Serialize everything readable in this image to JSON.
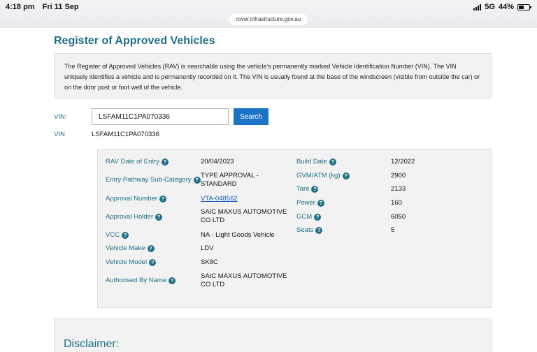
{
  "status_bar": {
    "time": "4:18 pm",
    "date": "Fri 11 Sep",
    "network": "5G",
    "battery": "44%"
  },
  "browser": {
    "url": "rover.infrastructure.gov.au"
  },
  "page": {
    "title": "Register of Approved Vehicles",
    "intro": "The Register of Approved Vehicles (RAV) is searchable using the vehicle's permanently marked Vehicle Identification Number (VIN). The VIN uniquely identifies a vehicle and is permanently recorded on it. The VIN is usually found at the base of the windscreen (visible from outside the car) or on the door post or foot well of the vehicle."
  },
  "search": {
    "label": "VIN:",
    "value": "LSFAM11C1PA070336",
    "button": "Search"
  },
  "result_vin": {
    "label": "VIN",
    "value": "LSFAM11C1PA070336"
  },
  "details": {
    "left": [
      {
        "label": "RAV Date of Entry",
        "value": "20/04/2023"
      },
      {
        "label": "Entry Pathway Sub-Category",
        "value_line1": "TYPE APPROVAL -",
        "value_line2": "STANDARD"
      },
      {
        "label": "Approval Number",
        "value": "VTA-048562"
      },
      {
        "label": "Approval Holder",
        "value_line1": "SAIC MAXUS AUTOMOTIVE",
        "value_line2": "CO LTD"
      },
      {
        "label": "VCC",
        "value": "NA - Light Goods Vehicle"
      },
      {
        "label": "Vehicle Make",
        "value": "LDV"
      },
      {
        "label": "Vehicle Model",
        "value": "SK8C"
      },
      {
        "label": "Authorised By Name",
        "value_line1": "SAIC MAXUS AUTOMOTIVE",
        "value_line2": "CO LTD"
      }
    ],
    "right": [
      {
        "label": "Build Date",
        "value": "12/2022"
      },
      {
        "label": "GVM/ATM (kg)",
        "value": "2900"
      },
      {
        "label": "Tare",
        "value": "2133"
      },
      {
        "label": "Power",
        "value": "160"
      },
      {
        "label": "GCM",
        "value": "6050"
      },
      {
        "label": "Seats",
        "value": "5"
      }
    ]
  },
  "disclaimer": {
    "title": "Disclaimer:"
  },
  "icons": {
    "help": "question-circle-icon",
    "signal": "cellular-signal-icon",
    "battery": "battery-icon"
  },
  "colors": {
    "heading": "#1e6f86",
    "button": "#1a74c6",
    "panel": "#f2f2f2",
    "link": "#1a5db5"
  }
}
